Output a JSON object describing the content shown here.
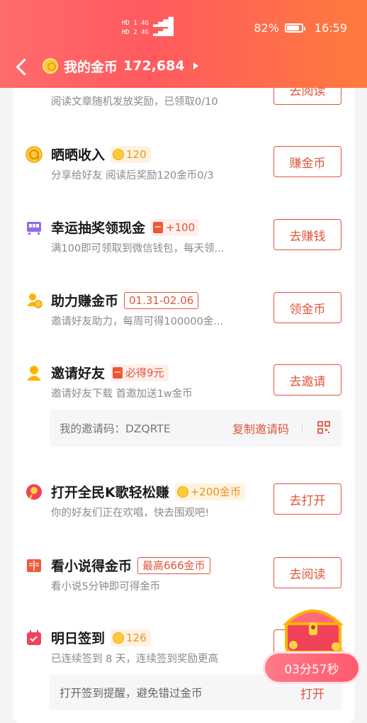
{
  "status_bar": {
    "sim1": "HD 1 4G",
    "sim2": "HD 2 4G",
    "battery": "82%",
    "time": "16:59"
  },
  "nav": {
    "title": "我的金币",
    "coins": "172,684"
  },
  "tasks": [
    {
      "title": "",
      "desc": "阅读文章随机发放奖励，已领取0/10",
      "button": "去阅读"
    },
    {
      "title": "晒晒收入",
      "badge": "120",
      "desc": "分享给好友 阅读后奖励120金币0/3",
      "button": "赚金币",
      "icon": "coin-share-icon"
    },
    {
      "title": "幸运抽奖领现金",
      "badge": "+100",
      "desc": "满100即可领取到微信钱包，每天领...",
      "button": "去赚钱",
      "icon": "lottery-icon"
    },
    {
      "title": "助力赚金币",
      "badge": "01.31-02.06",
      "desc": "邀请好友助力，每周可得100000金...",
      "button": "领金币",
      "icon": "assist-icon"
    },
    {
      "title": "邀请好友",
      "badge": "必得9元",
      "desc": "邀请好友下载 首邀加送1w金币",
      "button": "去邀请",
      "icon": "user-icon"
    },
    {
      "title": "打开全民K歌轻松赚",
      "badge": "+200金币",
      "desc": "你的好友们正在欢唱，快去围观吧!",
      "button": "去打开",
      "icon": "karaoke-icon"
    },
    {
      "title": "看小说得金币",
      "badge": "最高666金币",
      "desc": "看小说5分钟即可得金币",
      "button": "去阅读",
      "icon": "book-icon"
    },
    {
      "title": "明日签到",
      "badge": "126",
      "desc": "已连续签到 8 天，连续签到奖励更高",
      "button": "",
      "icon": "calendar-icon"
    }
  ],
  "invite": {
    "code_label": "我的邀请码：DZQRTE",
    "copy_label": "复制邀请码"
  },
  "sign": {
    "reminder": "打开签到提醒，避免错过金币",
    "open_label": "打开"
  },
  "timer": "03分57秒",
  "colors": {
    "header": "#ff5a5f",
    "accent": "#e0553b",
    "coin": "#ffc93a"
  }
}
